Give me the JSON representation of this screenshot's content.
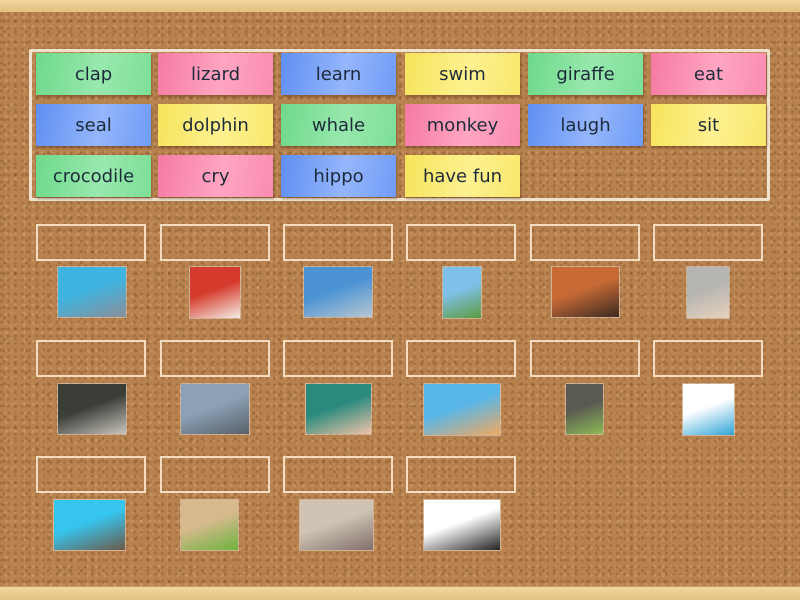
{
  "word_bank": [
    {
      "label": "clap",
      "color": "green"
    },
    {
      "label": "lizard",
      "color": "pink"
    },
    {
      "label": "learn",
      "color": "blue"
    },
    {
      "label": "swim",
      "color": "yellow"
    },
    {
      "label": "giraffe",
      "color": "green"
    },
    {
      "label": "eat",
      "color": "pink"
    },
    {
      "label": "seal",
      "color": "blue"
    },
    {
      "label": "dolphin",
      "color": "yellow"
    },
    {
      "label": "whale",
      "color": "green"
    },
    {
      "label": "monkey",
      "color": "pink"
    },
    {
      "label": "laugh",
      "color": "blue"
    },
    {
      "label": "sit",
      "color": "yellow"
    },
    {
      "label": "crocodile",
      "color": "green"
    },
    {
      "label": "cry",
      "color": "pink"
    },
    {
      "label": "hippo",
      "color": "blue"
    },
    {
      "label": "have fun",
      "color": "yellow"
    }
  ],
  "targets": [
    {
      "image": "dolphin-photo",
      "colors": [
        "#3fb4e0",
        "#8a8f99"
      ]
    },
    {
      "image": "boy-eating-photo",
      "colors": [
        "#d53b2c",
        "#f5ede6"
      ]
    },
    {
      "image": "whale-photo",
      "colors": [
        "#4c93d4",
        "#b9c7d1"
      ]
    },
    {
      "image": "giraffe-photo",
      "colors": [
        "#7fc0e8",
        "#5c9b3d"
      ]
    },
    {
      "image": "person-sitting-photo",
      "colors": [
        "#c76a36",
        "#3c2a22"
      ]
    },
    {
      "image": "child-clapping-photo",
      "colors": [
        "#b7b5b1",
        "#e6d2bd"
      ]
    },
    {
      "image": "crocodile-photo",
      "colors": [
        "#3a3d38",
        "#c9c5bd"
      ]
    },
    {
      "image": "seal-photo",
      "colors": [
        "#8ca1b6",
        "#59606a"
      ]
    },
    {
      "image": "child-crying-photo",
      "colors": [
        "#2a8a7d",
        "#f0c3a8"
      ]
    },
    {
      "image": "children-having-fun-photo",
      "colors": [
        "#59b7e8",
        "#f0a860"
      ]
    },
    {
      "image": "monkey-photo",
      "colors": [
        "#5b5a52",
        "#8bbb55"
      ]
    },
    {
      "image": "woman-laughing-photo",
      "colors": [
        "#ffffff",
        "#2fa4d7"
      ]
    },
    {
      "image": "child-swimming-photo",
      "colors": [
        "#36c5ef",
        "#6b5a48"
      ]
    },
    {
      "image": "lizard-photo",
      "colors": [
        "#d6b98c",
        "#6db33e"
      ]
    },
    {
      "image": "hippo-photo",
      "colors": [
        "#cfc4b3",
        "#7f6e6a"
      ]
    },
    {
      "image": "person-learning-illustration",
      "colors": [
        "#ffffff",
        "#222222"
      ]
    }
  ]
}
